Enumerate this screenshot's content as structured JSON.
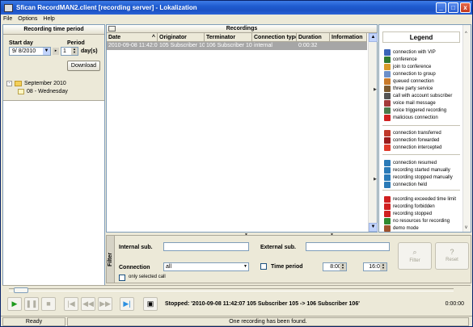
{
  "window": {
    "title": "Sfican RecordMAN2.client [recording server] - Lokalization",
    "minimize_label": "_",
    "maximize_label": "□",
    "close_label": "x"
  },
  "menu": {
    "items": [
      "File",
      "Options",
      "Help"
    ]
  },
  "left_panel": {
    "title": "Recording time period",
    "start_day_label": "Start day",
    "start_day_value": "9/ 8/2010",
    "period_label": "Period",
    "period_value": "1",
    "period_unit": "day(s)",
    "download_label": "Download",
    "tree": [
      {
        "expander": "-",
        "label": "September 2010"
      },
      {
        "label": "08 - Wednesday"
      }
    ]
  },
  "recordings": {
    "title": "Recordings",
    "columns": [
      "Date",
      "Originator",
      "Terminator",
      "Connection type",
      "Duration",
      "Information"
    ],
    "rows": [
      {
        "date": "2010-09-08 11:42:07",
        "originator": "105 Subscriber 105",
        "terminator": "106 Subscriber 106",
        "connection_type": "internal",
        "duration": "0:00:32",
        "information": ""
      }
    ]
  },
  "legend": {
    "title": "Legend",
    "items": [
      {
        "label": "connection with VIP",
        "color": "#3a64b8"
      },
      {
        "label": "conference",
        "color": "#2f7a2f"
      },
      {
        "label": "join to conference",
        "color": "#d89b2a"
      },
      {
        "label": "connection to group",
        "color": "#6b8fc9"
      },
      {
        "label": "queued connection",
        "color": "#c97a2a"
      },
      {
        "label": "three party service",
        "color": "#7c5a2f"
      },
      {
        "label": "call with account subscriber",
        "color": "#555555"
      },
      {
        "label": "voice mail message",
        "color": "#a33a3a"
      },
      {
        "label": "voice triggered recording",
        "color": "#4a7a4a"
      },
      {
        "label": "malicious connection",
        "color": "#d02020"
      },
      {
        "label": "connection transferred",
        "color": "#c0392b"
      },
      {
        "label": "connection forwarded",
        "color": "#9b1c1c"
      },
      {
        "label": "connection intercepted",
        "color": "#e03a2a"
      },
      {
        "label": "connection resumed",
        "color": "#2a7ab8"
      },
      {
        "label": "recording started manually",
        "color": "#2a7ab8"
      },
      {
        "label": "recording stopped manually",
        "color": "#2a7ab8"
      },
      {
        "label": "connection held",
        "color": "#2a7ab8"
      },
      {
        "label": "recording exceeded time limit",
        "color": "#d02020"
      },
      {
        "label": "recording forbidden",
        "color": "#d02020"
      },
      {
        "label": "recording stopped",
        "color": "#d02020"
      },
      {
        "label": "no resources for recording",
        "color": "#2f8a2f"
      },
      {
        "label": "demo mode",
        "color": "#a0522d"
      }
    ]
  },
  "filter": {
    "tab_label": "Filter",
    "internal_sub_label": "Internal sub.",
    "internal_sub_value": "",
    "external_sub_label": "External sub.",
    "external_sub_value": "",
    "connection_label": "Connection",
    "connection_value": "all",
    "time_period_label": "Time period",
    "time_from": "8:00",
    "time_to": "16:00",
    "only_selected_label": "only selected call",
    "filter_button": "Filter",
    "reset_button": "Reset"
  },
  "player": {
    "status_text": "Stopped: '2010-09-08 11:42:07  105 Subscriber 105 -> 106 Subscriber 106'",
    "time": "0:00:00"
  },
  "statusbar": {
    "ready": "Ready",
    "message": "One recording has been found."
  }
}
